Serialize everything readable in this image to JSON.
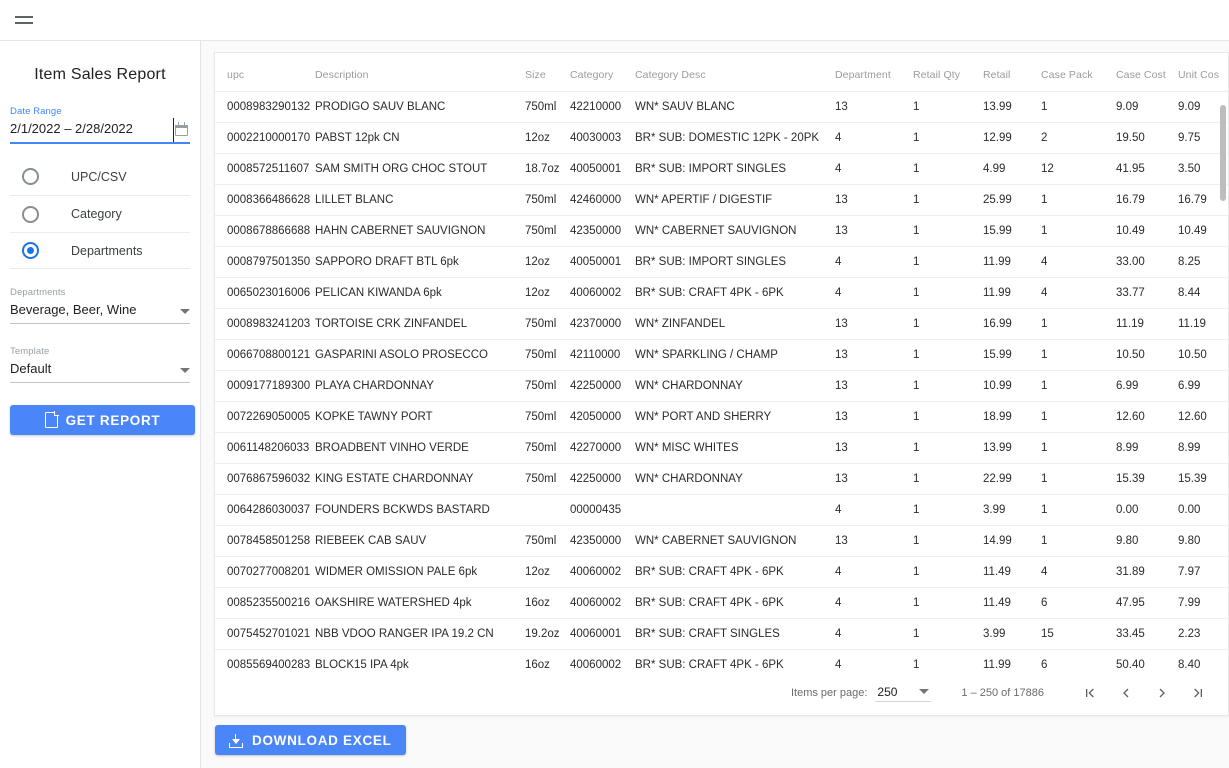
{
  "topbar": {
    "menu_icon": "hamburger-menu-icon"
  },
  "sidebar": {
    "title": "Item Sales Report",
    "date_range": {
      "label": "Date Range",
      "value": "2/1/2022 – 2/28/2022",
      "icon": "calendar-icon"
    },
    "radio_options": [
      {
        "label": "UPC/CSV",
        "selected": false
      },
      {
        "label": "Category",
        "selected": false
      },
      {
        "label": "Departments",
        "selected": true
      }
    ],
    "departments_select": {
      "label": "Departments",
      "value": "Beverage, Beer, Wine"
    },
    "template_select": {
      "label": "Template",
      "value": "Default"
    },
    "get_report_label": "GET REPORT"
  },
  "table": {
    "columns": [
      "upc",
      "Description",
      "Size",
      "Category",
      "Category Desc",
      "Department",
      "Retail Qty",
      "Retail",
      "Case Pack",
      "Case Cost",
      "Unit Cos"
    ],
    "rows": [
      [
        "0008983290132",
        "PRODIGO SAUV BLANC",
        "750ml",
        "42210000",
        "WN* SAUV BLANC",
        "13",
        "1",
        "13.99",
        "1",
        "9.09",
        "9.09"
      ],
      [
        "0002210000170",
        "PABST 12pk CN",
        "12oz",
        "40030003",
        "BR* SUB: DOMESTIC 12PK - 20PK",
        "4",
        "1",
        "12.99",
        "2",
        "19.50",
        "9.75"
      ],
      [
        "0008572511607",
        "SAM SMITH ORG CHOC STOUT",
        "18.7oz",
        "40050001",
        "BR* SUB: IMPORT SINGLES",
        "4",
        "1",
        "4.99",
        "12",
        "41.95",
        "3.50"
      ],
      [
        "0008366486628",
        "LILLET BLANC",
        "750ml",
        "42460000",
        "WN* APERTIF / DIGESTIF",
        "13",
        "1",
        "25.99",
        "1",
        "16.79",
        "16.79"
      ],
      [
        "0008678866688",
        "HAHN CABERNET SAUVIGNON",
        "750ml",
        "42350000",
        "WN* CABERNET SAUVIGNON",
        "13",
        "1",
        "15.99",
        "1",
        "10.49",
        "10.49"
      ],
      [
        "0008797501350",
        "SAPPORO DRAFT BTL 6pk",
        "12oz",
        "40050001",
        "BR* SUB: IMPORT SINGLES",
        "4",
        "1",
        "11.99",
        "4",
        "33.00",
        "8.25"
      ],
      [
        "0065023016006",
        "PELICAN KIWANDA 6pk",
        "12oz",
        "40060002",
        "BR* SUB: CRAFT 4PK - 6PK",
        "4",
        "1",
        "11.99",
        "4",
        "33.77",
        "8.44"
      ],
      [
        "0008983241203",
        "TORTOISE CRK ZINFANDEL",
        "750ml",
        "42370000",
        "WN* ZINFANDEL",
        "13",
        "1",
        "16.99",
        "1",
        "11.19",
        "11.19"
      ],
      [
        "0066708800121",
        "GASPARINI ASOLO PROSECCO",
        "750ml",
        "42110000",
        "WN* SPARKLING / CHAMP",
        "13",
        "1",
        "15.99",
        "1",
        "10.50",
        "10.50"
      ],
      [
        "0009177189300",
        "PLAYA CHARDONNAY",
        "750ml",
        "42250000",
        "WN* CHARDONNAY",
        "13",
        "1",
        "10.99",
        "1",
        "6.99",
        "6.99"
      ],
      [
        "0072269050005",
        "KOPKE TAWNY PORT",
        "750ml",
        "42050000",
        "WN* PORT AND SHERRY",
        "13",
        "1",
        "18.99",
        "1",
        "12.60",
        "12.60"
      ],
      [
        "0061148206033",
        "BROADBENT VINHO VERDE",
        "750ml",
        "42270000",
        "WN* MISC WHITES",
        "13",
        "1",
        "13.99",
        "1",
        "8.99",
        "8.99"
      ],
      [
        "0076867596032",
        "KING ESTATE CHARDONNAY",
        "750ml",
        "42250000",
        "WN* CHARDONNAY",
        "13",
        "1",
        "22.99",
        "1",
        "15.39",
        "15.39"
      ],
      [
        "0064286030037",
        "FOUNDERS BCKWDS BASTARD",
        "",
        "00000435",
        "",
        "4",
        "1",
        "3.99",
        "1",
        "0.00",
        "0.00"
      ],
      [
        "0078458501258",
        "RIEBEEK CAB SAUV",
        "750ml",
        "42350000",
        "WN* CABERNET SAUVIGNON",
        "13",
        "1",
        "14.99",
        "1",
        "9.80",
        "9.80"
      ],
      [
        "0070277008201",
        "WIDMER OMISSION PALE 6pk",
        "12oz",
        "40060002",
        "BR* SUB: CRAFT 4PK - 6PK",
        "4",
        "1",
        "11.49",
        "4",
        "31.89",
        "7.97"
      ],
      [
        "0085235500216",
        "OAKSHIRE WATERSHED 4pk",
        "16oz",
        "40060002",
        "BR* SUB: CRAFT 4PK - 6PK",
        "4",
        "1",
        "11.49",
        "6",
        "47.95",
        "7.99"
      ],
      [
        "0075452701021",
        "NBB VDOO RANGER IPA 19.2 CN",
        "19.2oz",
        "40060001",
        "BR* SUB: CRAFT SINGLES",
        "4",
        "1",
        "3.99",
        "15",
        "33.45",
        "2.23"
      ],
      [
        "0085569400283",
        "BLOCK15 IPA 4pk",
        "16oz",
        "40060002",
        "BR* SUB: CRAFT 4PK - 6PK",
        "4",
        "1",
        "11.99",
        "6",
        "50.40",
        "8.40"
      ]
    ]
  },
  "paginator": {
    "items_per_page_label": "Items per page:",
    "items_per_page_value": "250",
    "range_label": "1 – 250 of 17886",
    "first_page_icon": "first-page-icon",
    "prev_page_icon": "previous-page-icon",
    "next_page_icon": "next-page-icon",
    "last_page_icon": "last-page-icon"
  },
  "download_button": {
    "label": "DOWNLOAD EXCEL",
    "icon": "download-icon"
  },
  "colors": {
    "accent_blue": "#4a86f7",
    "focus_blue": "#4285f4",
    "radio_selected": "#1a73e8",
    "page_background": "#fafafa",
    "card_background": "#ffffff"
  }
}
